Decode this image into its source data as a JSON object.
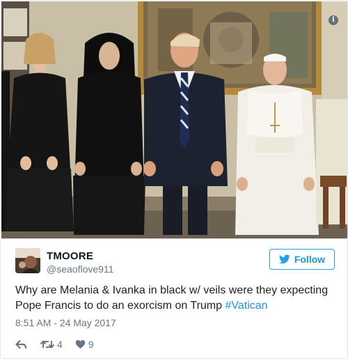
{
  "photo": {
    "alt_icon": "info-icon"
  },
  "tweet": {
    "display_name": "TMOORE",
    "handle": "@seaoflove911",
    "follow_label": "Follow",
    "text_main": "Why are Melania & Ivanka in black w/ veils were they expecting Pope Francis to do an exorcism on Trump ",
    "hashtag": "#Vatican",
    "timestamp": "8:51 AM - 24 May 2017",
    "retweet_count": "4",
    "like_count": "9"
  },
  "colors": {
    "accent": "#1b95e0",
    "muted": "#657786",
    "border": "#e1e8ed"
  },
  "icons": {
    "follow": "twitter-bird-icon",
    "reply": "reply-icon",
    "retweet": "retweet-icon",
    "like": "heart-icon"
  }
}
